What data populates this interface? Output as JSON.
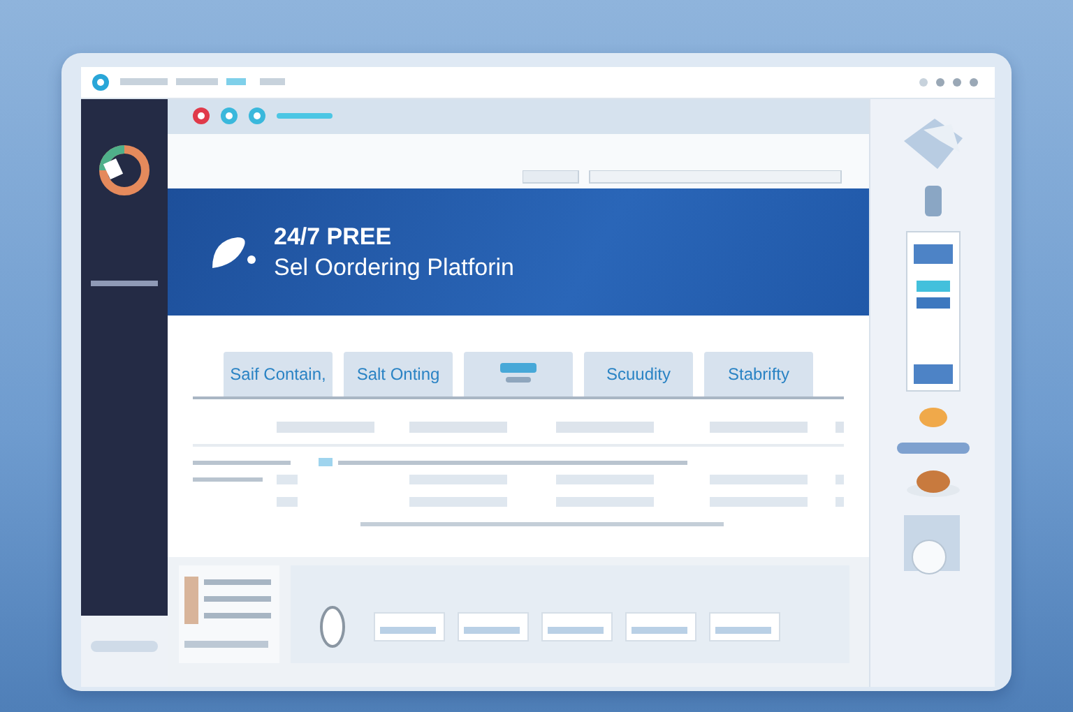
{
  "banner": {
    "headline": "24/7 PREE",
    "subheadline": "Sel Oordering Platforin"
  },
  "tabs": [
    {
      "kind": "text",
      "label": "Saif Contain,",
      "selected": false
    },
    {
      "kind": "text",
      "label": "Salt Onting",
      "selected": false
    },
    {
      "kind": "icon",
      "selected": false
    },
    {
      "kind": "text",
      "label": "Scuudity",
      "selected": false
    },
    {
      "kind": "text",
      "label": "Stabrifty",
      "selected": false
    }
  ]
}
